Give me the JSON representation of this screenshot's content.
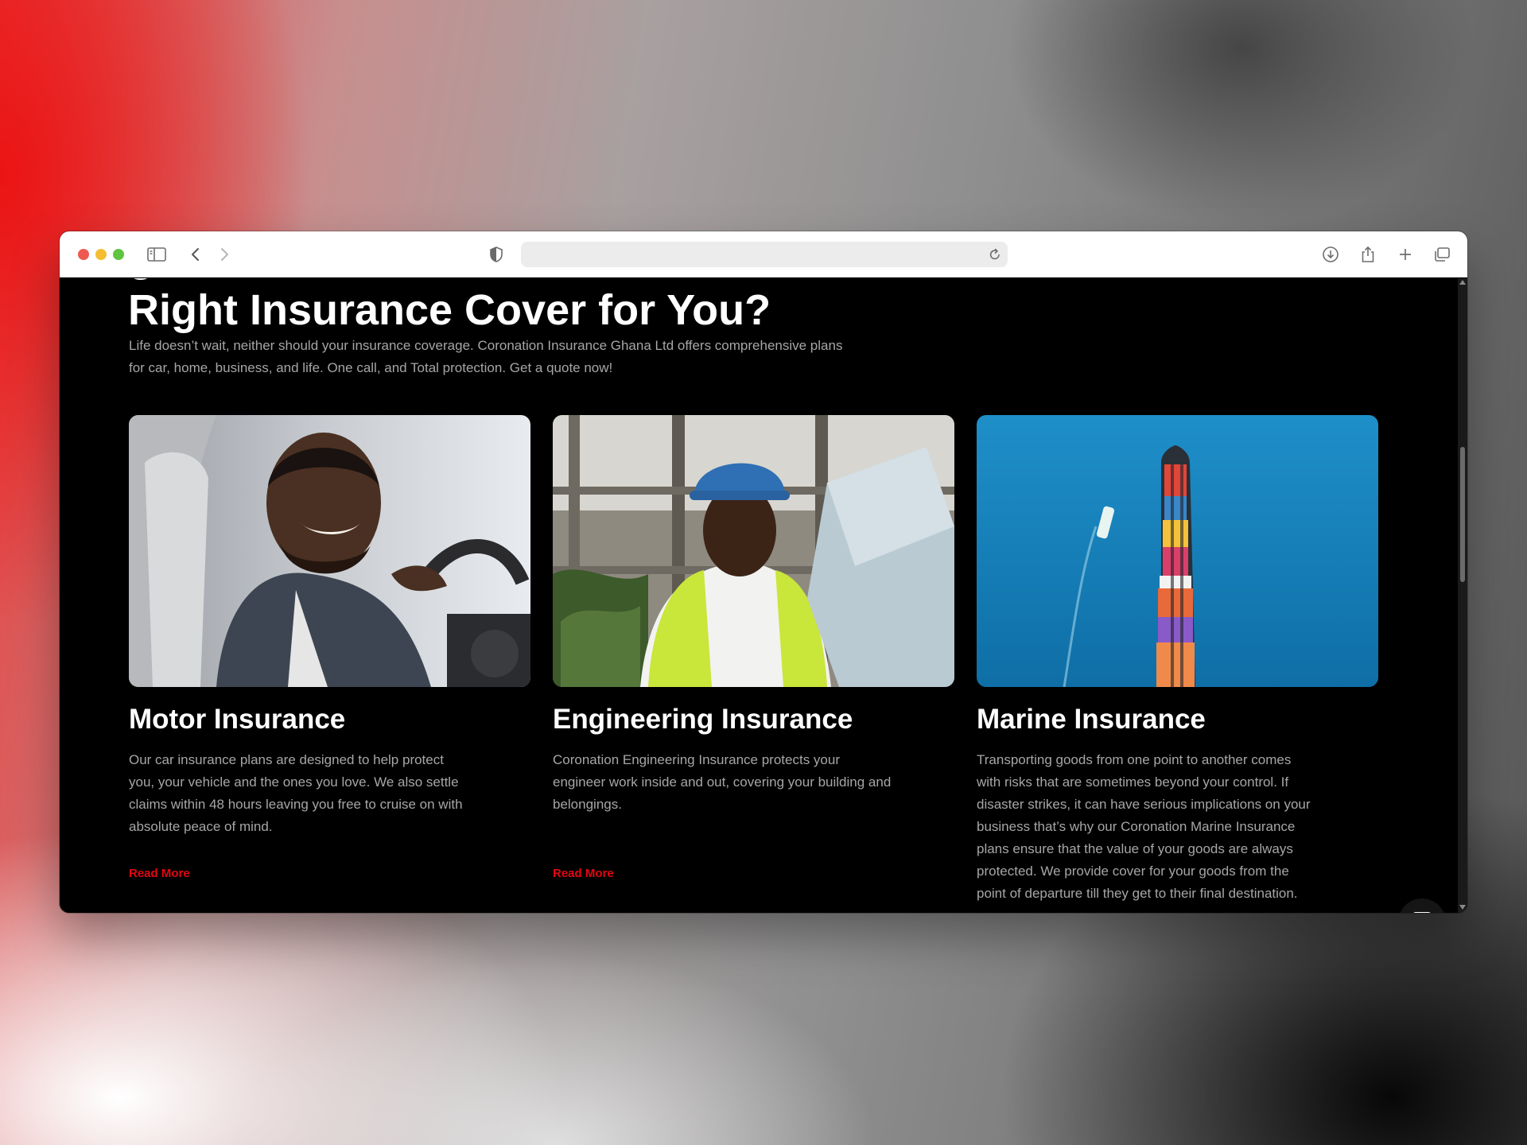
{
  "browser": {
    "url": "",
    "icons": [
      "sidebar-icon",
      "back-icon",
      "forward-icon",
      "shield-icon",
      "reload-icon",
      "download-icon",
      "share-icon",
      "new-tab-icon",
      "tab-overview-icon"
    ]
  },
  "hero": {
    "headline_partial": "g",
    "headline": "Right Insurance Cover for You?",
    "intro": "Life doesn’t wait, neither should your insurance coverage. Coronation Insurance Ghana Ltd offers comprehensive plans for car, home, business, and life. One call, and Total protection. Get a quote now!"
  },
  "cards": [
    {
      "title": "Motor Insurance",
      "body": "Our car insurance plans are designed to help protect you, your vehicle and the ones you love. We also settle claims within 48 hours leaving you free to cruise on with absolute peace of mind.",
      "link": "Read More"
    },
    {
      "title": "Engineering Insurance",
      "body": "Coronation Engineering Insurance protects your engineer work inside and out, covering your building and belongings.",
      "link": "Read More"
    },
    {
      "title": "Marine Insurance",
      "body": "Transporting goods from one point to another comes with risks that are sometimes beyond your control. If disaster strikes, it can have serious implications on your business  that’s why our Coronation Marine Insurance plans ensure that the value of your goods are always protected. We provide cover for your goods from the point of departure till they get to their final destination."
    }
  ],
  "chat": {
    "icon": "chat-icon"
  },
  "colors": {
    "accent": "#e30613",
    "page_bg": "#000000",
    "muted_text": "#a6a6a6"
  }
}
